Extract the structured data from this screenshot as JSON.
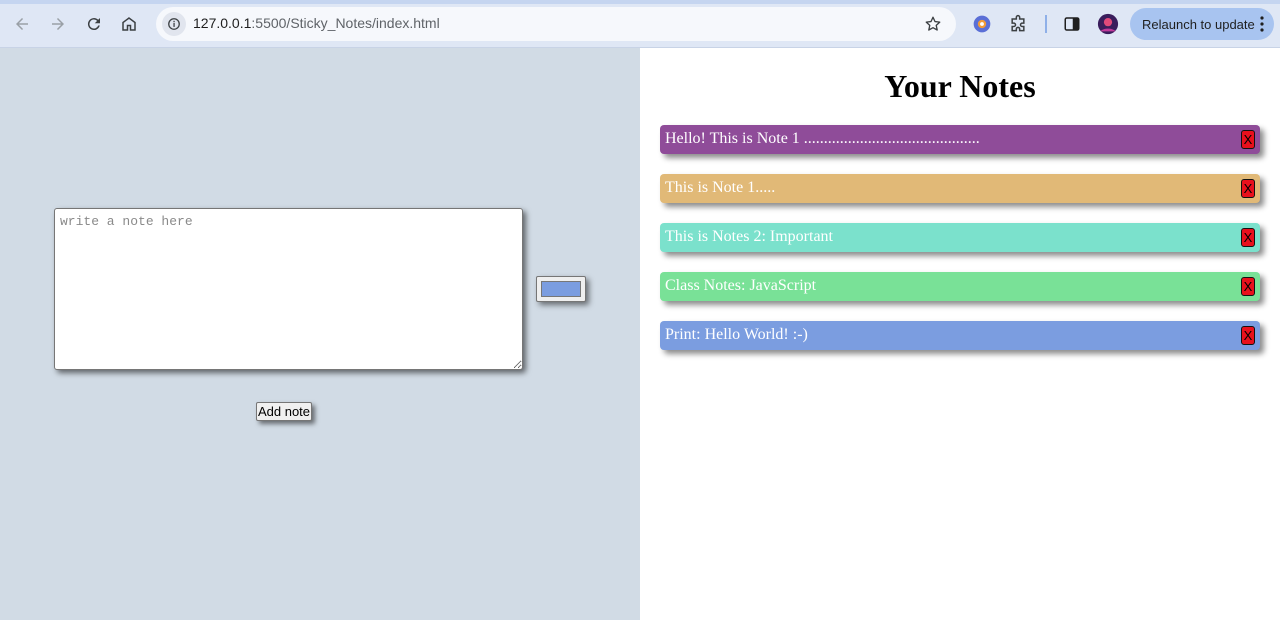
{
  "browser": {
    "url_host": "127.0.0.1",
    "url_path": ":5500/Sticky_Notes/index.html",
    "relaunch_label": "Relaunch to update"
  },
  "form": {
    "textarea_placeholder": "write a note here",
    "textarea_value": "",
    "color_value": "#7b9de0",
    "add_label": "Add note"
  },
  "notes_panel": {
    "title": "Your Notes",
    "delete_label": "X",
    "notes": [
      {
        "text": "Hello! This is Note 1 ............................................",
        "color": "#8f4c99"
      },
      {
        "text": "This is Note 1.....",
        "color": "#e1b977"
      },
      {
        "text": "This is Notes 2: Important",
        "color": "#7be1cc"
      },
      {
        "text": "Class Notes: JavaScript",
        "color": "#79e197"
      },
      {
        "text": "Print: Hello World! :-)",
        "color": "#7b9de0"
      }
    ]
  }
}
